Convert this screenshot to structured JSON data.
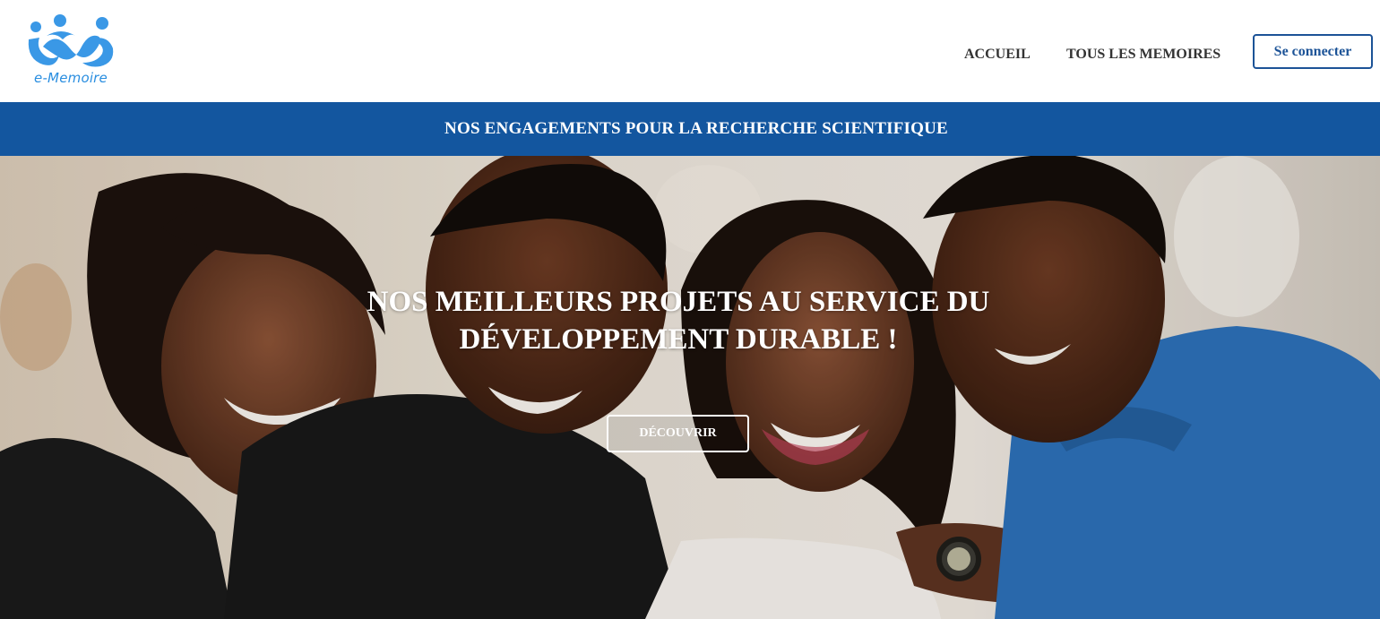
{
  "brand": {
    "logo_icon": "people-infinity-logo-icon",
    "logo_text": "e-Memoire",
    "color": "#2a8ee0"
  },
  "nav": {
    "items": [
      {
        "label": "ACCUEIL"
      },
      {
        "label": "TOUS LES MEMOIRES"
      }
    ],
    "login_label": "Se connecter"
  },
  "strip": {
    "text": "NOS ENGAGEMENTS POUR LA RECHERCHE SCIENTIFIQUE",
    "color": "#13569f"
  },
  "hero": {
    "image": "students-group-photo",
    "title_line1": "NOS MEILLEURS PROJETS AU SERVICE DU",
    "title_line2": "DÉVELOPPEMENT DURABLE !",
    "cta_label": "DÉCOUVRIR"
  },
  "colors": {
    "primary": "#1c5397",
    "strip": "#13569f",
    "nav_text": "#333333"
  }
}
